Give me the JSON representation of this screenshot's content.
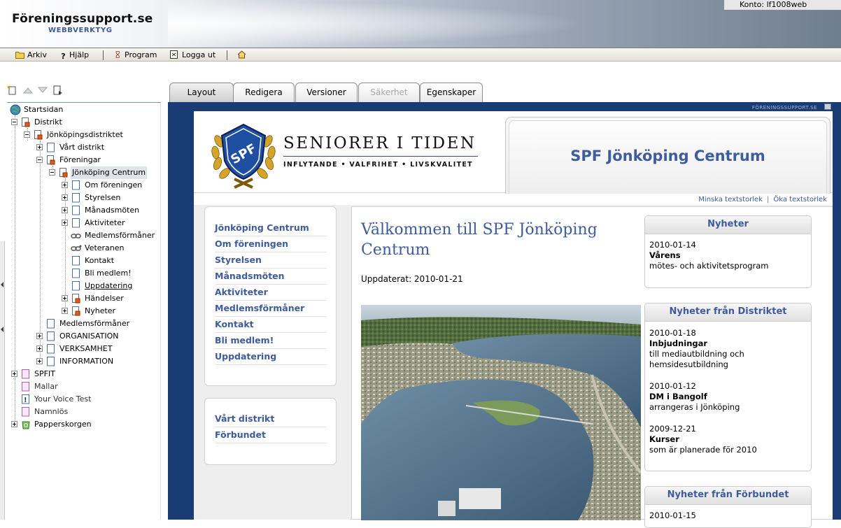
{
  "header": {
    "brand_title": "Föreningssupport.se",
    "brand_subtitle": "WEBBVERKTYG",
    "account": "Konto: lf1008web"
  },
  "toolbar": {
    "archive": "Arkiv",
    "help": "Hjälp",
    "program": "Program",
    "logout": "Logga ut"
  },
  "tree": {
    "root": "Startsidan",
    "items": [
      "Distrikt",
      "Jönköpingsdistriktet",
      "Vårt distrikt",
      "Föreningar",
      "Jönköping Centrum",
      "Om föreningen",
      "Styrelsen",
      "Månadsmöten",
      "Aktiviteter",
      "Medlemsförmåner",
      "Veteranen",
      "Kontakt",
      "Bli medlem!",
      "Uppdatering",
      "Händelser",
      "Nyheter",
      "Medlemsförmåner",
      "ORGANISATION",
      "VERKSAMHET",
      "INFORMATION",
      "SPFIT",
      "Mallar",
      "Your Voice Test",
      "Namnlös",
      "Papperskorgen"
    ]
  },
  "tabs": [
    "Layout",
    "Redigera",
    "Versioner",
    "Säkerhet",
    "Egenskaper"
  ],
  "editor": {
    "watermark": "FÖRENINGSSUPPORT.SE"
  },
  "site": {
    "logo_emblem": "SPF",
    "logo_name": "SENIORER I TIDEN",
    "logo_tagline": "INFLYTANDE • VALFRIHET • LIVSKVALITET",
    "org_title": "SPF Jönköping Centrum",
    "text_smaller": "Minska textstorlek",
    "text_larger": "Öka textstorlek",
    "nav_main": [
      "Jönköping Centrum",
      "Om föreningen",
      "Styrelsen",
      "Månadsmöten",
      "Aktiviteter",
      "Medlemsförmåner",
      "Kontakt",
      "Bli medlem!",
      "Uppdatering"
    ],
    "nav_secondary": [
      "Vårt distrikt",
      "Förbundet"
    ],
    "welcome": "Välkommen till SPF Jönköping Centrum",
    "updated": "Uppdaterat: 2010-01-21",
    "news": {
      "title": "Nyheter",
      "items": [
        {
          "date": "2010-01-14",
          "title": "Vårens",
          "text": "mötes- och aktivitetsprogram"
        }
      ]
    },
    "news_district": {
      "title": "Nyheter från Distriktet",
      "items": [
        {
          "date": "2010-01-18",
          "title": "Inbjudningar",
          "text1": "till mediautbildning och",
          "text2": "hemsidesutbildning"
        },
        {
          "date": "2010-01-12",
          "title": "DM i Bangolf",
          "text1": "arrangeras i Jönköping",
          "text2": ""
        },
        {
          "date": "2009-12-21",
          "title": "Kurser",
          "text1": "som är planerade för 2010",
          "text2": ""
        }
      ]
    },
    "news_federation": {
      "title": "Nyheter från Förbundet",
      "partial_date": "2010-01-15"
    }
  },
  "colors": {
    "link_blue": "#3e5c9c",
    "editor_bg": "#1a3c74"
  }
}
